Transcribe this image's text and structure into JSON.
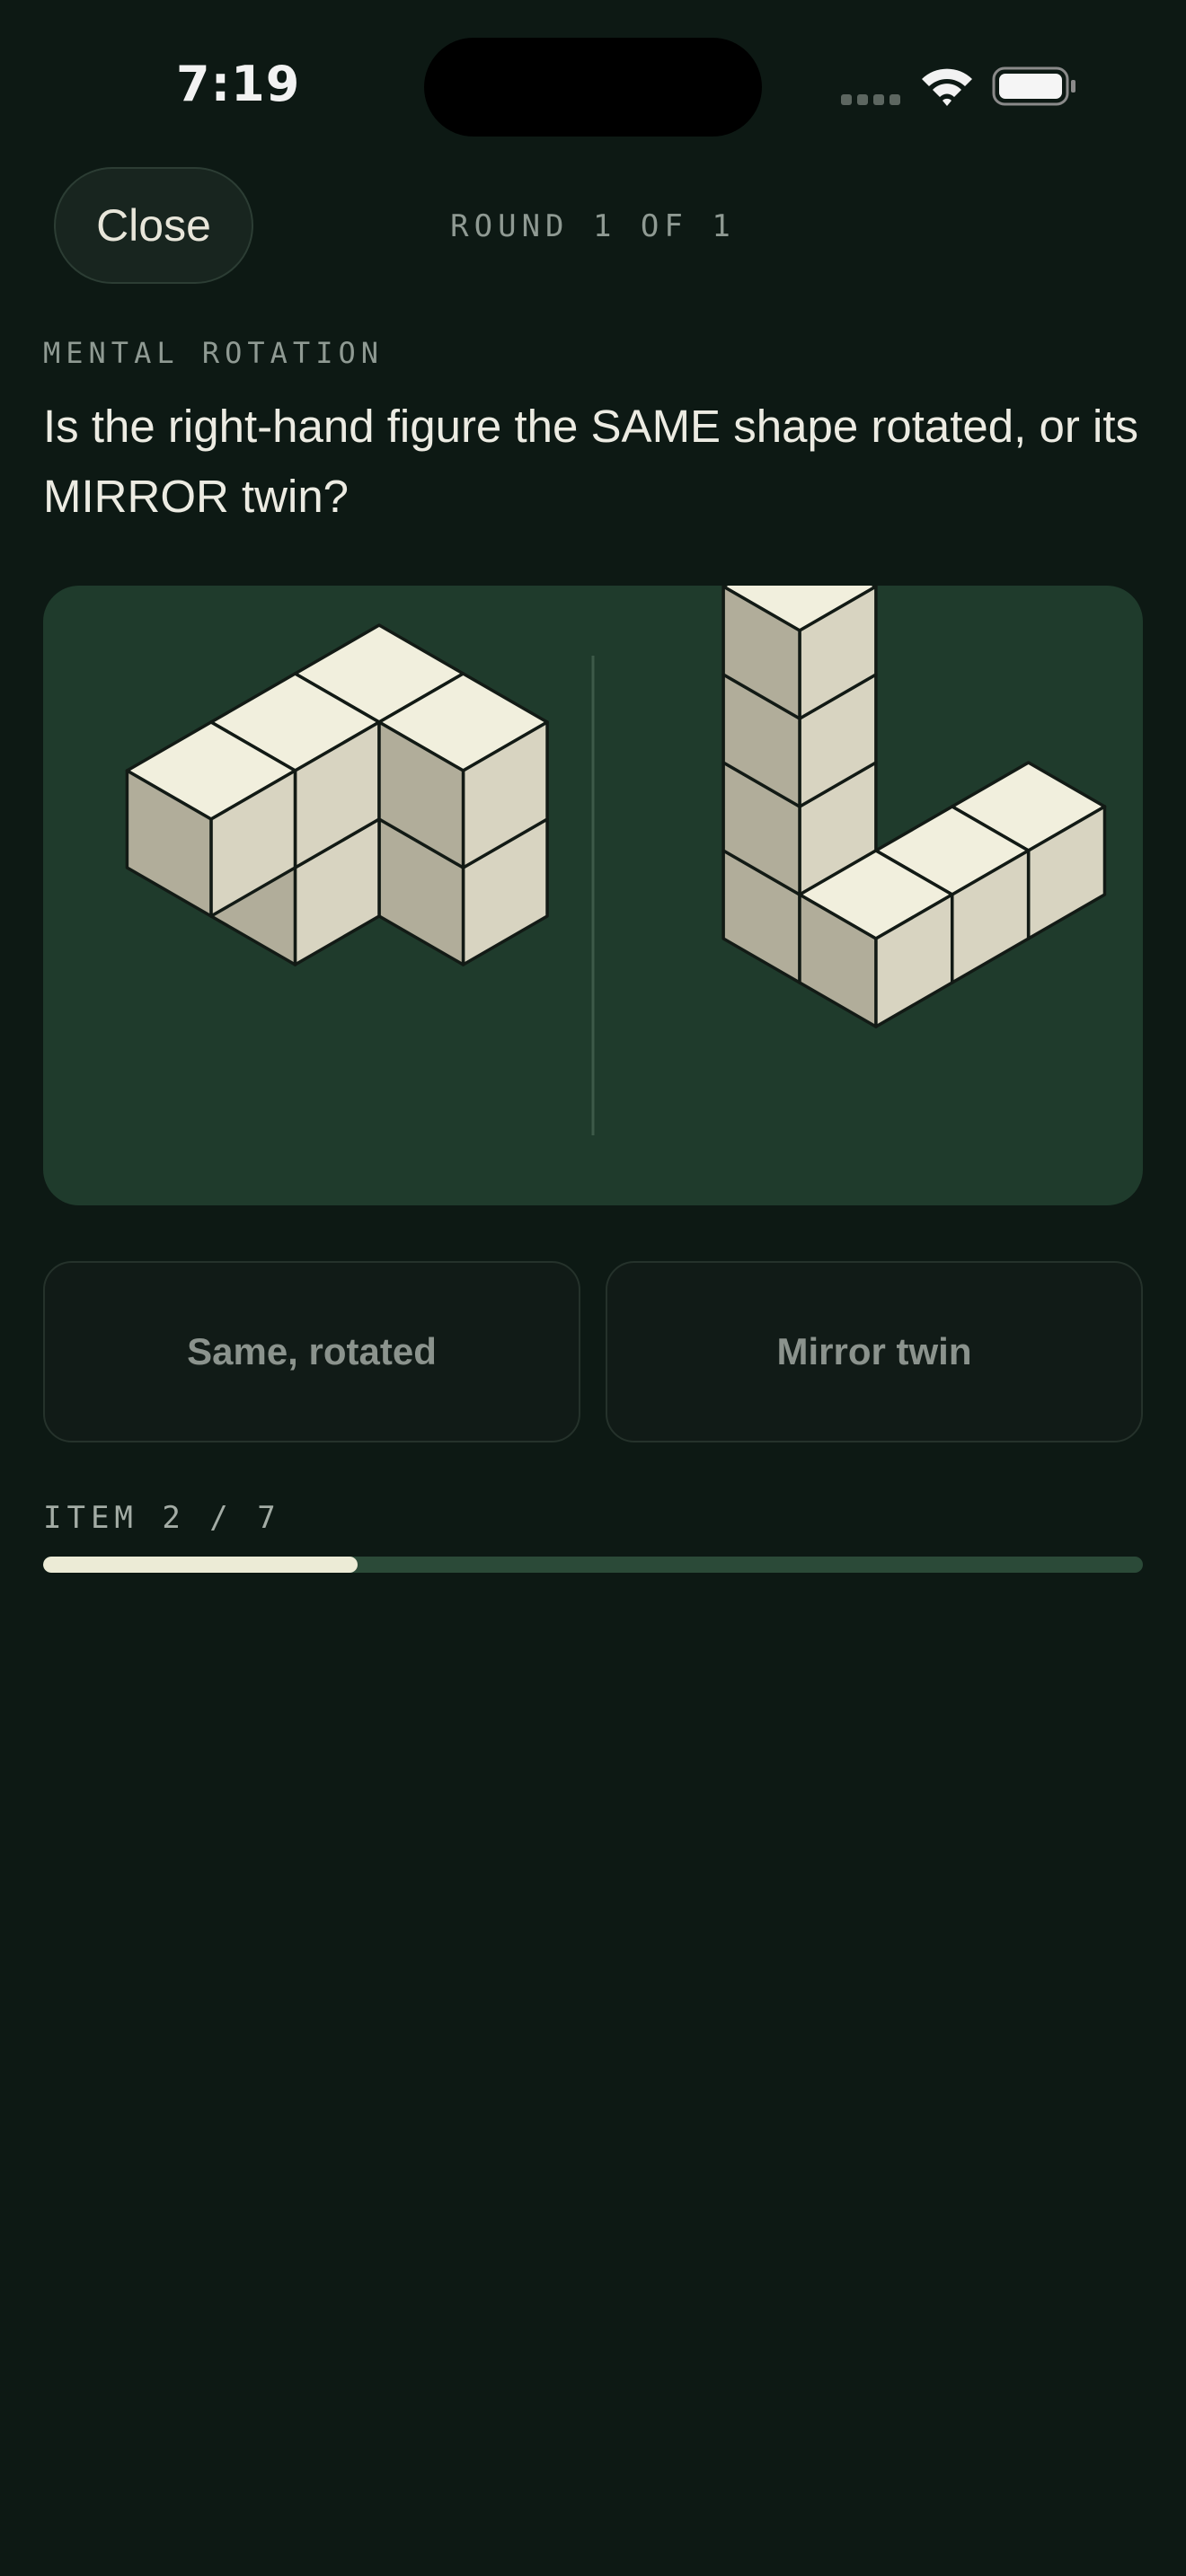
{
  "status_bar": {
    "time": "7:19",
    "icons": [
      "cellular-signal-icon",
      "wifi-icon",
      "battery-icon"
    ]
  },
  "header": {
    "close_label": "Close",
    "round_label": "ROUND 1 OF 1"
  },
  "task": {
    "section_label": "MENTAL ROTATION",
    "question": "Is the right-hand figure the SAME shape rotated, or its MIRROR twin?"
  },
  "figures": {
    "left": "cube-figure",
    "right": "cube-figure"
  },
  "answers": {
    "same_label": "Same, rotated",
    "mirror_label": "Mirror twin"
  },
  "progress": {
    "label": "ITEM 2 / 7",
    "fraction": 0.2857
  },
  "colors": {
    "background": "#0d1914",
    "card": "#1f3b2c",
    "cube_top": "#f1efdd",
    "cube_right": "#d8d4c1",
    "cube_left": "#b1ad9a",
    "progress_fill": "#ecebd6",
    "progress_track": "#2b4a38"
  }
}
